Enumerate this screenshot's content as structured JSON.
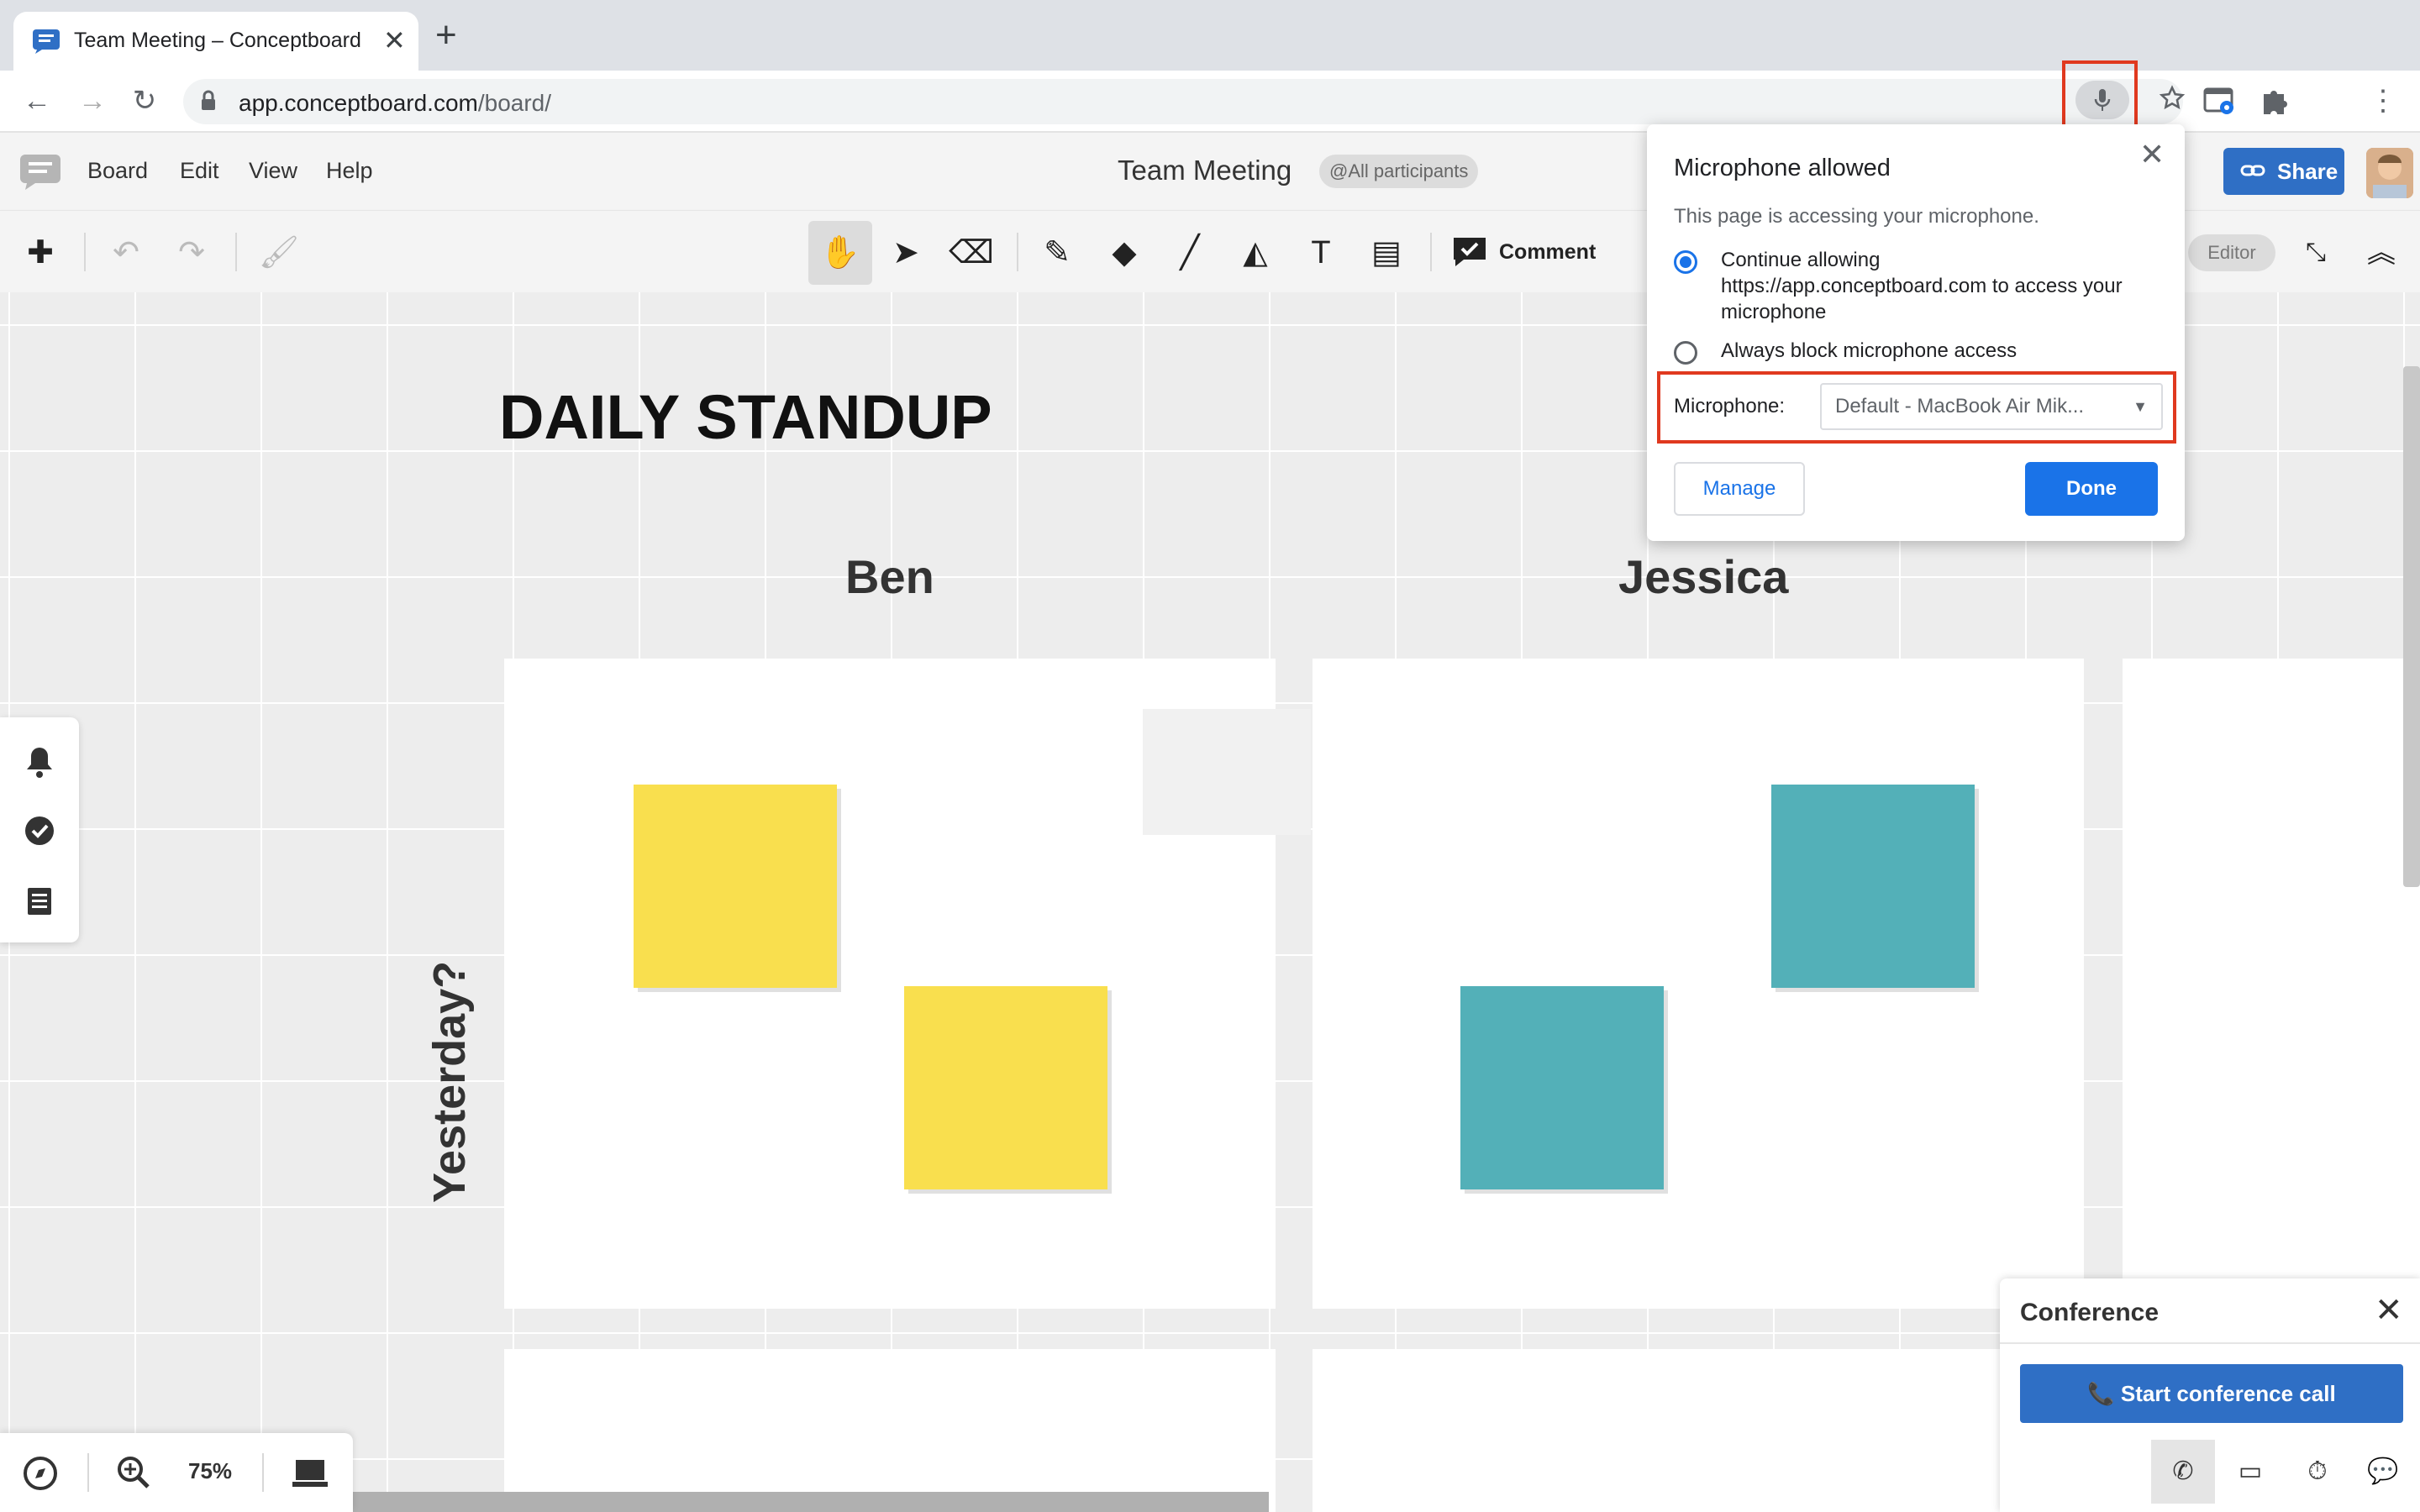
{
  "browser": {
    "tab_title": "Team Meeting – Conceptboard",
    "tab_close": "✕",
    "new_tab": "+",
    "url_host": "app.conceptboard.com",
    "url_path": "/board/"
  },
  "app": {
    "menu": [
      "Board",
      "Edit",
      "View",
      "Help"
    ],
    "board_title": "Team Meeting",
    "participants_badge": "@All participants",
    "share_label": "Share",
    "comment_label": "Comment",
    "mode_badge": "Editor"
  },
  "board": {
    "heading": "DAILY STANDUP",
    "columns": [
      "Ben",
      "Jessica"
    ],
    "row_label": "Yesterday?",
    "colors": {
      "yellow": "#f9df4e",
      "teal": "#53b0b8"
    }
  },
  "zoom": {
    "level": "75%"
  },
  "conference": {
    "title": "Conference",
    "call_label": "Start conference call"
  },
  "mic_popup": {
    "title": "Microphone allowed",
    "description": "This page is accessing your microphone.",
    "option_allow": "Continue allowing https://app.conceptboard.com to access your microphone",
    "option_block": "Always block microphone access",
    "selected_option": "allow",
    "microphone_label": "Microphone:",
    "microphone_value": "Default - MacBook Air Mik...",
    "manage_label": "Manage",
    "done_label": "Done"
  },
  "colors": {
    "accent": "#1a73e8",
    "brand": "#2f6fc5",
    "highlight": "#e0391f"
  }
}
